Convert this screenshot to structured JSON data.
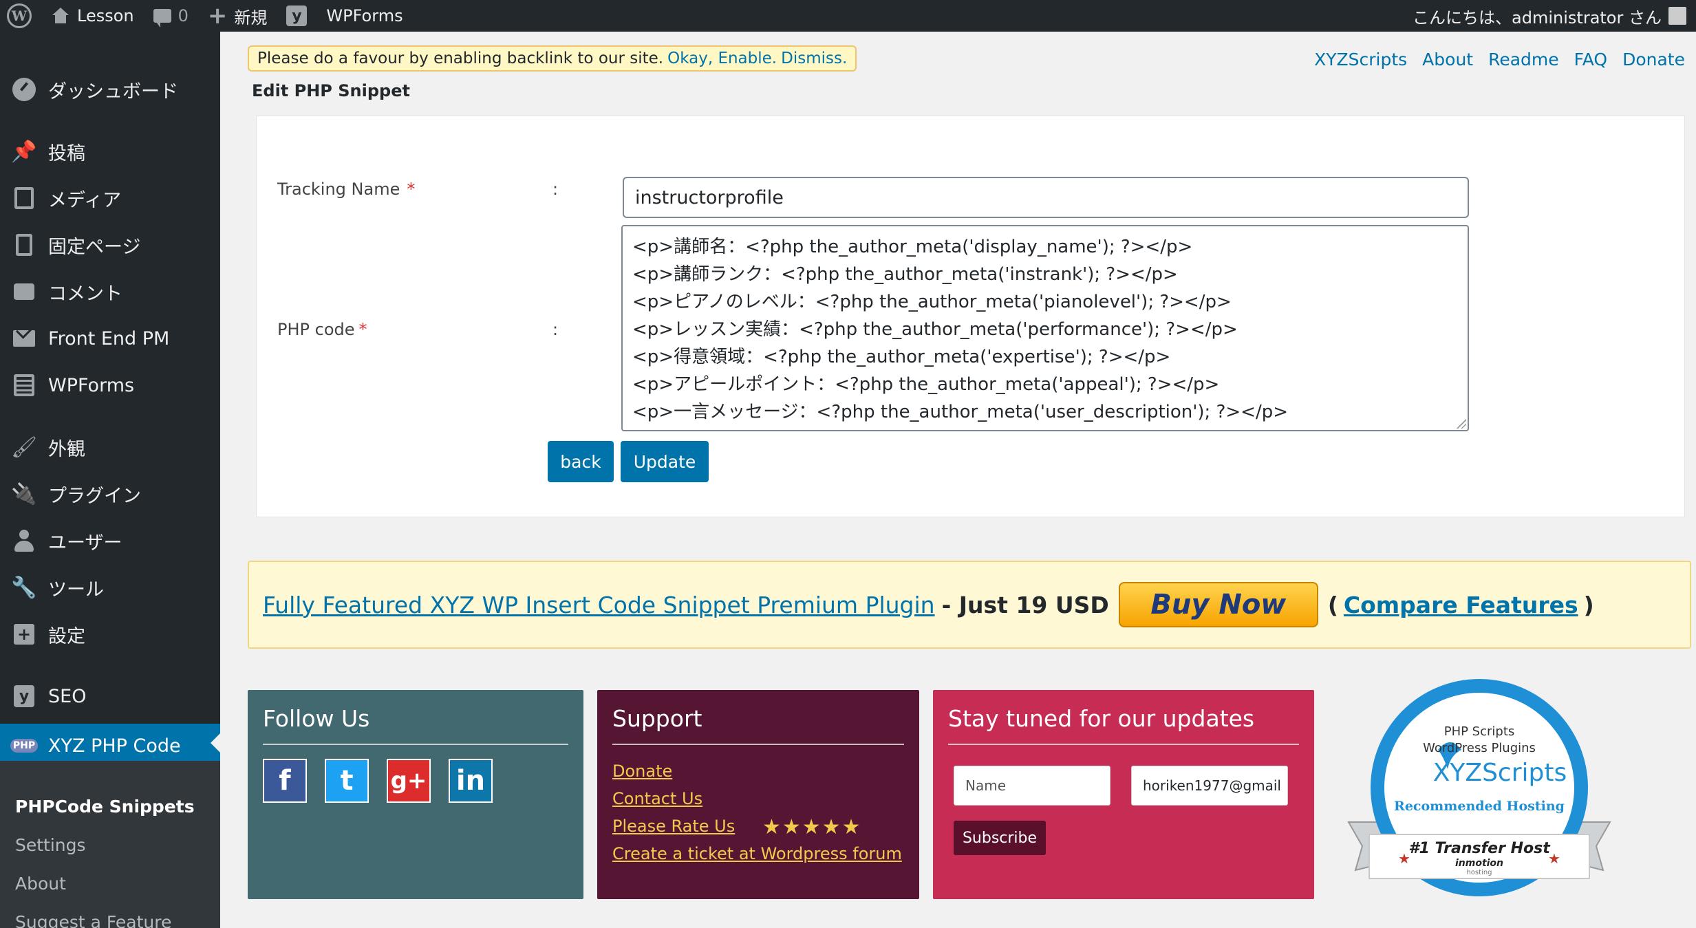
{
  "adminbar": {
    "site_name": "Lesson",
    "comments_count": "0",
    "new_label": "新規",
    "wpforms_label": "WPForms",
    "greeting": "こんにちは、administrator さん"
  },
  "sidebar": {
    "items": [
      {
        "label": "ダッシュボード",
        "icon": "dashboard-icon"
      },
      {
        "label": "投稿",
        "icon": "pin-icon"
      },
      {
        "label": "メディア",
        "icon": "media-icon"
      },
      {
        "label": "固定ページ",
        "icon": "page-icon"
      },
      {
        "label": "コメント",
        "icon": "comment-icon"
      },
      {
        "label": "Front End PM",
        "icon": "mail-icon"
      },
      {
        "label": "WPForms",
        "icon": "forms-icon"
      },
      {
        "label": "外観",
        "icon": "brush-icon"
      },
      {
        "label": "プラグイン",
        "icon": "plugin-icon"
      },
      {
        "label": "ユーザー",
        "icon": "user-icon"
      },
      {
        "label": "ツール",
        "icon": "wrench-icon"
      },
      {
        "label": "設定",
        "icon": "settings-icon"
      },
      {
        "label": "SEO",
        "icon": "yoast-icon"
      },
      {
        "label": "XYZ PHP Code",
        "icon": "php-icon",
        "badge": "PHP"
      }
    ],
    "submenu": [
      "PHPCode Snippets",
      "Settings",
      "About",
      "Suggest a Feature"
    ]
  },
  "notice": {
    "text": "Please do a favour by enabling backlink to our site.",
    "link_enable": "Okay, Enable.",
    "link_dismiss": "Dismiss."
  },
  "toplinks": [
    "XYZScripts",
    "About",
    "Readme",
    "FAQ",
    "Donate"
  ],
  "page_title": "Edit PHP Snippet",
  "form": {
    "tracking_label": "Tracking Name",
    "required_mark": "*",
    "colon": ":",
    "tracking_value": "instructorprofile",
    "code_label": "PHP code",
    "code_lines": [
      "<p>講師名：<?php the_author_meta('display_name'); ?></p>",
      "<p>講師ランク：<?php the_author_meta('instrank'); ?></p>",
      "<p>ピアノのレベル：<?php the_author_meta('pianolevel'); ?></p>",
      "<p>レッスン実績：<?php the_author_meta('performance'); ?></p>",
      "<p>得意領域：<?php the_author_meta('expertise'); ?></p>",
      "<p>アピールポイント：<?php the_author_meta('appeal'); ?></p>",
      "<p>一言メッセージ：<?php the_author_meta('user_description'); ?></p>"
    ],
    "back_label": "back",
    "update_label": "Update"
  },
  "promo": {
    "link_text": "Fully Featured XYZ WP Insert Code Snippet Premium Plugin",
    "price_text": "- Just 19 USD",
    "buy_now": "Buy Now",
    "compare_open": "(",
    "compare_link": "Compare Features",
    "compare_close": ")"
  },
  "follow": {
    "title": "Follow Us",
    "networks": [
      {
        "glyph": "f",
        "icon": "facebook-icon"
      },
      {
        "glyph": "t",
        "icon": "twitter-icon"
      },
      {
        "glyph": "g+",
        "icon": "google-plus-icon"
      },
      {
        "glyph": "in",
        "icon": "linkedin-icon"
      }
    ]
  },
  "support": {
    "title": "Support",
    "links": [
      "Donate",
      "Contact Us",
      "Please Rate Us",
      "Create a ticket at Wordpress forum"
    ],
    "stars": "★★★★★"
  },
  "subscribe": {
    "title": "Stay tuned for our updates",
    "name_placeholder": "Name",
    "email_value": "horiken1977@gmail",
    "button": "Subscribe"
  },
  "badge": {
    "line1": "PHP Scripts",
    "line2": "WordPress Plugins",
    "brand": "XYZScripts",
    "recommended": "Recommended Hosting",
    "ribbon": "#1 Transfer Host",
    "host": "inmotion",
    "host_sub": "hosting"
  },
  "colors": {
    "admin_dark": "#23282d",
    "accent": "#0073aa",
    "follow_bg": "#436970",
    "support_bg": "#561633",
    "subscribe_bg": "#c72c54"
  }
}
